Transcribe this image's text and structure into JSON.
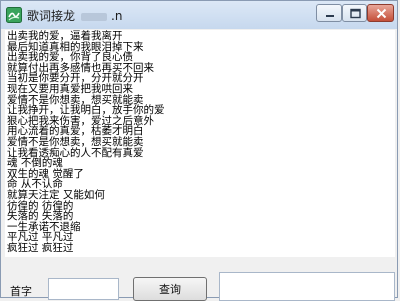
{
  "window": {
    "title": "歌词接龙",
    "title_suffix": ".n"
  },
  "lyrics": [
    "出卖我的爱，逼着我离开",
    "最后知道真相的我眼泪掉下来",
    "出卖我的爱，你背了良心债",
    "就算付出再多感情也再买不回来",
    "当初是你要分开，分开就分开",
    "现在又要用真爱把我哄回来",
    "爱情不是你想卖，想买就能卖",
    "让我挣开，让我明白，放手你的爱",
    "狠心把我来伤害，爱过之后意外",
    "用心流着的真爱，枯萎才明白",
    "爱情不是你想卖，想买就能卖",
    "让我看透痴心的人不配有真爱",
    "魂 不倒的魂",
    "双生的魂 觉醒了",
    "命 从不认命",
    "就算天注定 又能如何",
    "彷徨的 彷徨的",
    "失落的 失落的",
    "一生承诺不退缩",
    "平凡过 平凡过",
    "疯狂过 疯狂过"
  ],
  "form": {
    "label": "首字",
    "input_value": "",
    "button_label": "查询",
    "output_value": ""
  }
}
